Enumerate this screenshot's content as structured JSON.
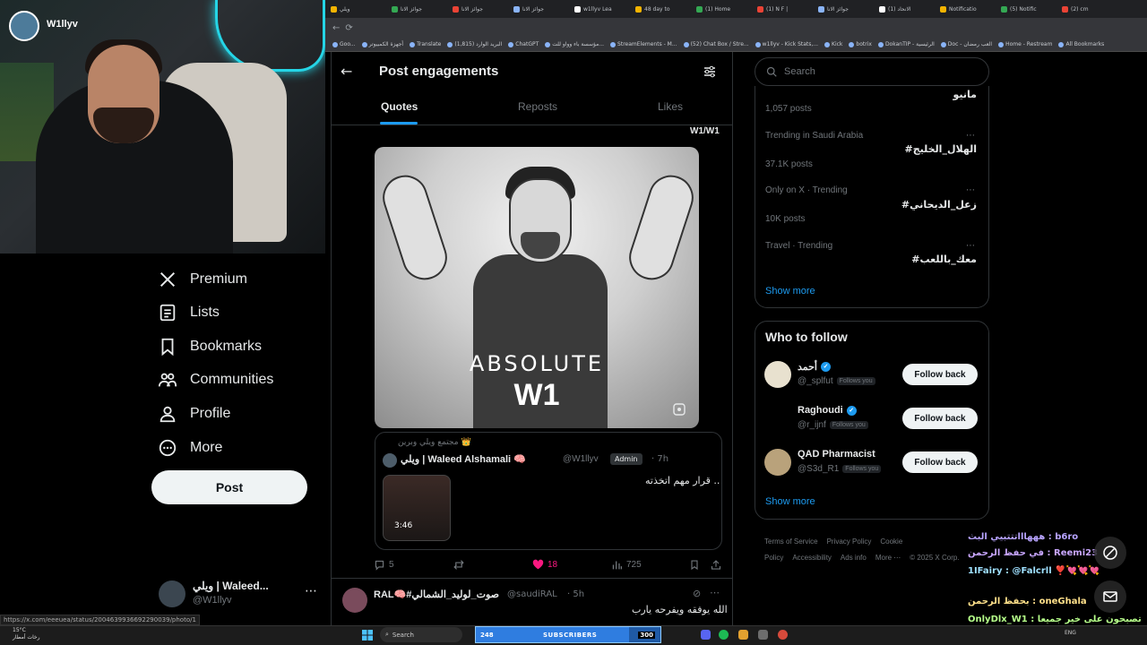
{
  "streamer": {
    "name": "W1llyv"
  },
  "browser": {
    "tabs": [
      "ويلي",
      "جوائز الانا",
      "جوائز الانا",
      "جوائز الانا",
      "w1llyv Lea",
      "48 day to",
      "(1) Home",
      "(1) N F |",
      "جوائز الانا",
      "(1) الانحاد",
      "Notificatio",
      "(5) Notific",
      "(2) cm"
    ],
    "bookmarks": [
      "Goo...",
      "أجهزة الكمبيوتر",
      "Translate",
      "البريد الوارد (1,815)",
      "ChatGPT",
      "مؤسسة باء وواو للت...",
      "StreamElements - M...",
      "(52) Chat Box / Stre...",
      "w1llyv - Kick Stats,...",
      "Kick",
      "botrix",
      "DokanTIP - الرئيسية",
      "Doc - العب رمضان",
      "Home - Restream",
      "All Bookmarks"
    ]
  },
  "nav": {
    "items": [
      {
        "label": "Premium",
        "icon": "x-logo-icon"
      },
      {
        "label": "Lists",
        "icon": "lists-icon"
      },
      {
        "label": "Bookmarks",
        "icon": "bookmark-icon"
      },
      {
        "label": "Communities",
        "icon": "communities-icon"
      },
      {
        "label": "Profile",
        "icon": "profile-icon"
      },
      {
        "label": "More",
        "icon": "more-circle-icon"
      }
    ],
    "post_button": "Post",
    "account": {
      "name": "ويلي | Waleed...",
      "handle": "@W1llyv",
      "more": "⋯"
    }
  },
  "status_url": "https://x.com/eeeuea/status/2004639936692290039/photo/1",
  "header": {
    "title": "Post engagements",
    "back": "←"
  },
  "tabs": [
    {
      "label": "Quotes",
      "active": true
    },
    {
      "label": "Reposts",
      "active": false
    },
    {
      "label": "Likes",
      "active": false
    }
  ],
  "post": {
    "top_label": "W1/W1",
    "media_title": "ABSOLUTE",
    "media_subtitle": "W1",
    "quote": {
      "community": "مجتمع ويلي وبرين 👑",
      "author": "ويلي | Waleed Alshamali 🧠",
      "handle": "@W1llyv",
      "badge": "Admin",
      "time": "· 7h",
      "text": "قرار مهم اتخذته ..",
      "duration": "3:46"
    },
    "actions": {
      "replies": "5",
      "likes": "18",
      "views": "725"
    }
  },
  "next_post": {
    "author": "RAL🧠#صوت_لوليد_الشمالي",
    "handle": "@saudiRAL",
    "time": "· 5h",
    "text": "الله يوفقه ويفرحه يارب",
    "more": "⋯"
  },
  "search": {
    "placeholder": "Search"
  },
  "trends": {
    "items": [
      {
        "name": "مانيو",
        "meta_above": "",
        "posts": "1,057 posts"
      },
      {
        "name": "#الهلال_الخليج",
        "meta_above": "Trending in Saudi Arabia",
        "posts": "37.1K posts"
      },
      {
        "name": "#زعل_الديحاني",
        "meta_above": "Only on X · Trending",
        "posts": "10K posts"
      },
      {
        "name": "#معك_باللعب",
        "meta_above": "Travel · Trending",
        "posts": ""
      }
    ],
    "show_more": "Show more"
  },
  "who_to_follow": {
    "title": "Who to follow",
    "users": [
      {
        "name": "أحمد",
        "handle": "@_splfut",
        "follows_you": "Follows you",
        "button": "Follow back"
      },
      {
        "name": "Raghoudi",
        "handle": "@r_ijnf",
        "follows_you": "Follows you",
        "button": "Follow back"
      },
      {
        "name": "QAD Pharmacist",
        "handle": "@S3d_R1",
        "follows_you": "Follows you",
        "button": "Follow back"
      }
    ],
    "show_more": "Show more"
  },
  "footer": {
    "links": [
      "Terms of Service",
      "Privacy Policy",
      "Cookie Policy",
      "Accessibility",
      "Ads info",
      "More ⋯",
      "© 2025 X Corp."
    ]
  },
  "chat": {
    "lines": [
      {
        "user": "",
        "text": "هههاااتتتبيي البث : b6ro",
        "color": "#b8a4ff"
      },
      {
        "user": "",
        "text": "في حفظ الرحمن : Reemi23",
        "color": "#c9a7ff"
      },
      {
        "user": "",
        "text": "1IFairy : @Falcrll ❣️💘💘💘",
        "color": "#9fe0ff"
      },
      {
        "user": "",
        "text": "بحفظ الرحمن : oneGhala",
        "color": "#ffe08a"
      },
      {
        "user": "",
        "text": "OnlyDlx_W1 : تصبحون على خير جميعا",
        "color": "#b6ff8a"
      }
    ]
  },
  "taskbar": {
    "weather": "15°C",
    "weather_sub": "رخات أمطار",
    "search": "Search",
    "subs_current": "248",
    "subs_label": "SUBSCRIBERS",
    "subs_goal": "300",
    "subs_progress": 0.83,
    "lang": "ENG"
  }
}
